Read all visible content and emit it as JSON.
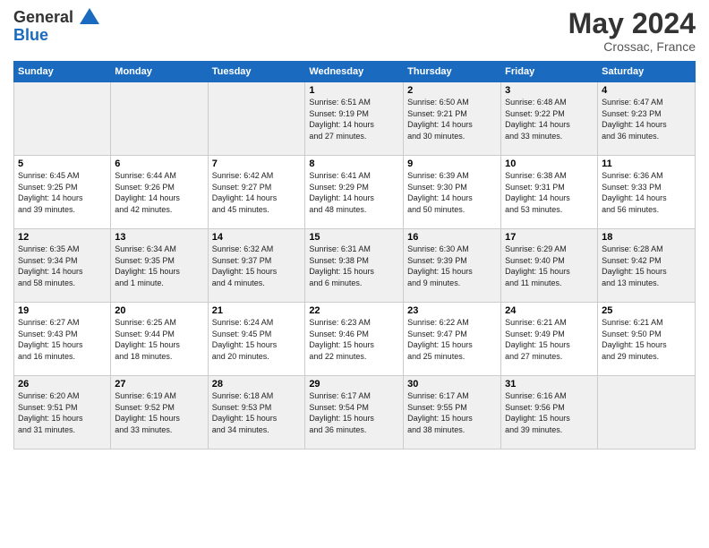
{
  "header": {
    "logo_line1": "General",
    "logo_line2": "Blue",
    "month": "May 2024",
    "location": "Crossac, France"
  },
  "days_of_week": [
    "Sunday",
    "Monday",
    "Tuesday",
    "Wednesday",
    "Thursday",
    "Friday",
    "Saturday"
  ],
  "weeks": [
    [
      {
        "day": "",
        "info": ""
      },
      {
        "day": "",
        "info": ""
      },
      {
        "day": "",
        "info": ""
      },
      {
        "day": "1",
        "info": "Sunrise: 6:51 AM\nSunset: 9:19 PM\nDaylight: 14 hours\nand 27 minutes."
      },
      {
        "day": "2",
        "info": "Sunrise: 6:50 AM\nSunset: 9:21 PM\nDaylight: 14 hours\nand 30 minutes."
      },
      {
        "day": "3",
        "info": "Sunrise: 6:48 AM\nSunset: 9:22 PM\nDaylight: 14 hours\nand 33 minutes."
      },
      {
        "day": "4",
        "info": "Sunrise: 6:47 AM\nSunset: 9:23 PM\nDaylight: 14 hours\nand 36 minutes."
      }
    ],
    [
      {
        "day": "5",
        "info": "Sunrise: 6:45 AM\nSunset: 9:25 PM\nDaylight: 14 hours\nand 39 minutes."
      },
      {
        "day": "6",
        "info": "Sunrise: 6:44 AM\nSunset: 9:26 PM\nDaylight: 14 hours\nand 42 minutes."
      },
      {
        "day": "7",
        "info": "Sunrise: 6:42 AM\nSunset: 9:27 PM\nDaylight: 14 hours\nand 45 minutes."
      },
      {
        "day": "8",
        "info": "Sunrise: 6:41 AM\nSunset: 9:29 PM\nDaylight: 14 hours\nand 48 minutes."
      },
      {
        "day": "9",
        "info": "Sunrise: 6:39 AM\nSunset: 9:30 PM\nDaylight: 14 hours\nand 50 minutes."
      },
      {
        "day": "10",
        "info": "Sunrise: 6:38 AM\nSunset: 9:31 PM\nDaylight: 14 hours\nand 53 minutes."
      },
      {
        "day": "11",
        "info": "Sunrise: 6:36 AM\nSunset: 9:33 PM\nDaylight: 14 hours\nand 56 minutes."
      }
    ],
    [
      {
        "day": "12",
        "info": "Sunrise: 6:35 AM\nSunset: 9:34 PM\nDaylight: 14 hours\nand 58 minutes."
      },
      {
        "day": "13",
        "info": "Sunrise: 6:34 AM\nSunset: 9:35 PM\nDaylight: 15 hours\nand 1 minute."
      },
      {
        "day": "14",
        "info": "Sunrise: 6:32 AM\nSunset: 9:37 PM\nDaylight: 15 hours\nand 4 minutes."
      },
      {
        "day": "15",
        "info": "Sunrise: 6:31 AM\nSunset: 9:38 PM\nDaylight: 15 hours\nand 6 minutes."
      },
      {
        "day": "16",
        "info": "Sunrise: 6:30 AM\nSunset: 9:39 PM\nDaylight: 15 hours\nand 9 minutes."
      },
      {
        "day": "17",
        "info": "Sunrise: 6:29 AM\nSunset: 9:40 PM\nDaylight: 15 hours\nand 11 minutes."
      },
      {
        "day": "18",
        "info": "Sunrise: 6:28 AM\nSunset: 9:42 PM\nDaylight: 15 hours\nand 13 minutes."
      }
    ],
    [
      {
        "day": "19",
        "info": "Sunrise: 6:27 AM\nSunset: 9:43 PM\nDaylight: 15 hours\nand 16 minutes."
      },
      {
        "day": "20",
        "info": "Sunrise: 6:25 AM\nSunset: 9:44 PM\nDaylight: 15 hours\nand 18 minutes."
      },
      {
        "day": "21",
        "info": "Sunrise: 6:24 AM\nSunset: 9:45 PM\nDaylight: 15 hours\nand 20 minutes."
      },
      {
        "day": "22",
        "info": "Sunrise: 6:23 AM\nSunset: 9:46 PM\nDaylight: 15 hours\nand 22 minutes."
      },
      {
        "day": "23",
        "info": "Sunrise: 6:22 AM\nSunset: 9:47 PM\nDaylight: 15 hours\nand 25 minutes."
      },
      {
        "day": "24",
        "info": "Sunrise: 6:21 AM\nSunset: 9:49 PM\nDaylight: 15 hours\nand 27 minutes."
      },
      {
        "day": "25",
        "info": "Sunrise: 6:21 AM\nSunset: 9:50 PM\nDaylight: 15 hours\nand 29 minutes."
      }
    ],
    [
      {
        "day": "26",
        "info": "Sunrise: 6:20 AM\nSunset: 9:51 PM\nDaylight: 15 hours\nand 31 minutes."
      },
      {
        "day": "27",
        "info": "Sunrise: 6:19 AM\nSunset: 9:52 PM\nDaylight: 15 hours\nand 33 minutes."
      },
      {
        "day": "28",
        "info": "Sunrise: 6:18 AM\nSunset: 9:53 PM\nDaylight: 15 hours\nand 34 minutes."
      },
      {
        "day": "29",
        "info": "Sunrise: 6:17 AM\nSunset: 9:54 PM\nDaylight: 15 hours\nand 36 minutes."
      },
      {
        "day": "30",
        "info": "Sunrise: 6:17 AM\nSunset: 9:55 PM\nDaylight: 15 hours\nand 38 minutes."
      },
      {
        "day": "31",
        "info": "Sunrise: 6:16 AM\nSunset: 9:56 PM\nDaylight: 15 hours\nand 39 minutes."
      },
      {
        "day": "",
        "info": ""
      }
    ]
  ]
}
